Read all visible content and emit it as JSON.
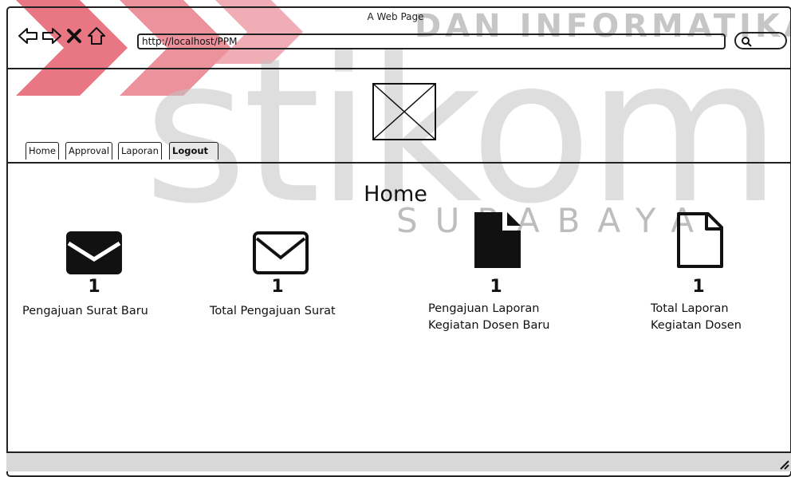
{
  "window": {
    "title": "A Web Page"
  },
  "browser": {
    "url": "http://localhost/PPM"
  },
  "watermark": {
    "top_text": "DAN INFORMATIKA",
    "brand": "stikom",
    "city": "SURABAYA"
  },
  "tabs": [
    {
      "label": "Home"
    },
    {
      "label": "Approval"
    },
    {
      "label": "Laporan"
    },
    {
      "label": "Logout"
    }
  ],
  "page": {
    "title": "Home"
  },
  "stats": [
    {
      "icon": "envelope-filled-icon",
      "count": "1",
      "label": "Pengajuan Surat Baru"
    },
    {
      "icon": "envelope-outline-icon",
      "count": "1",
      "label": "Total Pengajuan Surat"
    },
    {
      "icon": "document-filled-icon",
      "count": "1",
      "label_line1": "Pengajuan Laporan",
      "label_line2": "Kegiatan Dosen Baru"
    },
    {
      "icon": "document-outline-icon",
      "count": "1",
      "label_line1": "Total Laporan",
      "label_line2": "Kegiatan Dosen"
    }
  ],
  "colors": {
    "watermark_red": "#e04a5a",
    "watermark_gray": "#c4c4c4",
    "ink": "#111111",
    "footer": "#d8d8d8"
  }
}
